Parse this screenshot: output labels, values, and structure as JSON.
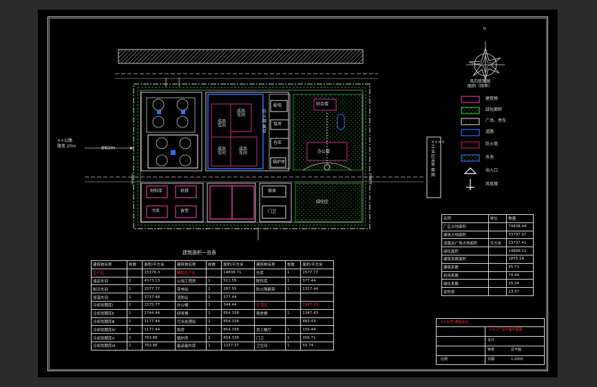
{
  "drawing": {
    "dimension_label": "860m",
    "north_label": "N",
    "entrance_note": [
      "××公路",
      "路宽 20m"
    ],
    "vertical_title": "××××工业区总平面图"
  },
  "rose": {
    "caption": [
      "风向玫瑰图",
      "图例（频率）"
    ]
  },
  "site_labels": {
    "bldg_a": "综合楼",
    "ws_1": [
      "成品",
      "车间"
    ],
    "ws_2": [
      "成品",
      "车间"
    ],
    "ws_3": [
      "成品",
      "车间"
    ],
    "ws_4": [
      "成品",
      "车间"
    ],
    "fire_zone": "防火隔离带",
    "office": "办公楼",
    "green": "绿化区",
    "guard": "门卫",
    "small_1": "配电",
    "small_2": "泵房",
    "small_3": "仓库",
    "small_4": "锅炉房",
    "small_5": "材料库",
    "small_6": "机修",
    "small_7": "冷库",
    "small_8": "食堂",
    "small_9": "宿舍"
  },
  "legend": {
    "items": [
      {
        "label": "建筑物",
        "color": "#d0308a"
      },
      {
        "label": "绿化面积",
        "color": "#34c234"
      },
      {
        "label": "广场、停车",
        "color": "#bfbfbf"
      },
      {
        "label": "道路",
        "color": "#2f6cff"
      },
      {
        "label": "防火墙",
        "color": "#c21a45"
      },
      {
        "label": "水池",
        "color": "#2f6cff"
      },
      {
        "label": "出入口",
        "color": "#ffffff"
      },
      {
        "label": "风玫瑰",
        "color": "#ffffff"
      }
    ]
  },
  "building_table": {
    "title": "建筑面积一览表",
    "headers": [
      "建筑物名称",
      "栋数",
      "面积/平方米",
      "建筑物名称",
      "栋数",
      "面积/平方米",
      "建筑物名称",
      "栋数",
      "面积/平方米"
    ],
    "rows": [
      [
        "生产区",
        "",
        "15378.3",
        "辅助生产区",
        "",
        "14838.71",
        "仓库",
        "1",
        "1577.77"
      ],
      [
        "成品车间",
        "1",
        "4573.13",
        "公用工程房",
        "1",
        "511.55",
        "配件库",
        "1",
        "377.44"
      ],
      [
        "制冷车间",
        "1",
        "1577.77",
        "变电站",
        "1",
        "287.55",
        "防火隔离带",
        "1",
        "1317.44"
      ],
      [
        "加温车间",
        "1",
        "3737.48",
        "消防站",
        "1",
        "377.44",
        "",
        "",
        ""
      ],
      [
        "冷却发酵库Ⅰ",
        "1",
        "1575.77",
        "办公楼",
        "1",
        "344.44",
        "生活区",
        "",
        "1987.31"
      ],
      [
        "冷却发酵库Ⅱ",
        "1",
        "2744.44",
        "研发楼",
        "1",
        "854.338",
        "宿舍楼",
        "1",
        "1347.43"
      ],
      [
        "冷却发酵库Ⅲ",
        "1",
        "1177.44",
        "污水处理站",
        "1",
        "854.338",
        "",
        "",
        "483.43"
      ],
      [
        "冷却发酵库Ⅳ",
        "1",
        "1177.44",
        "泵房",
        "1",
        "854.338",
        "员工餐厅",
        "1",
        "155.44"
      ],
      [
        "冷却发酵库Ⅴ",
        "1",
        "763.88",
        "锅炉房",
        "1",
        "854.338",
        "门卫",
        "1",
        "356.71"
      ],
      [
        "冷却发酵库Ⅵ",
        "1",
        "763.88",
        "备品备件库",
        "1",
        "1237.37",
        "卫生间",
        "1",
        "55.74"
      ]
    ]
  },
  "tech_table": {
    "headers": [
      "名称",
      "单位",
      "数量"
    ],
    "unit": "平方米",
    "rows": [
      [
        "厂区占地面积",
        "74838.44"
      ],
      [
        "建筑占地面积",
        "33797.97"
      ],
      [
        "道路及广场占地面积",
        "13737.41"
      ],
      [
        "绿化面积",
        "14688.11"
      ],
      [
        "建筑系数面积",
        "1855.14"
      ],
      [
        "建筑系数",
        "45.71"
      ],
      [
        "利用系数",
        "74.44"
      ],
      [
        "绿化系数",
        "15.34"
      ],
      [
        "容积率",
        "13.37"
      ]
    ]
  },
  "title_block": {
    "school": "××大学 课程设计",
    "project": "××工厂总平面布置图",
    "rows": [
      [
        "设计",
        ""
      ],
      [
        "审核",
        "总平面"
      ],
      [
        "日期",
        "1:2000"
      ],
      [
        "比例",
        ""
      ]
    ]
  }
}
